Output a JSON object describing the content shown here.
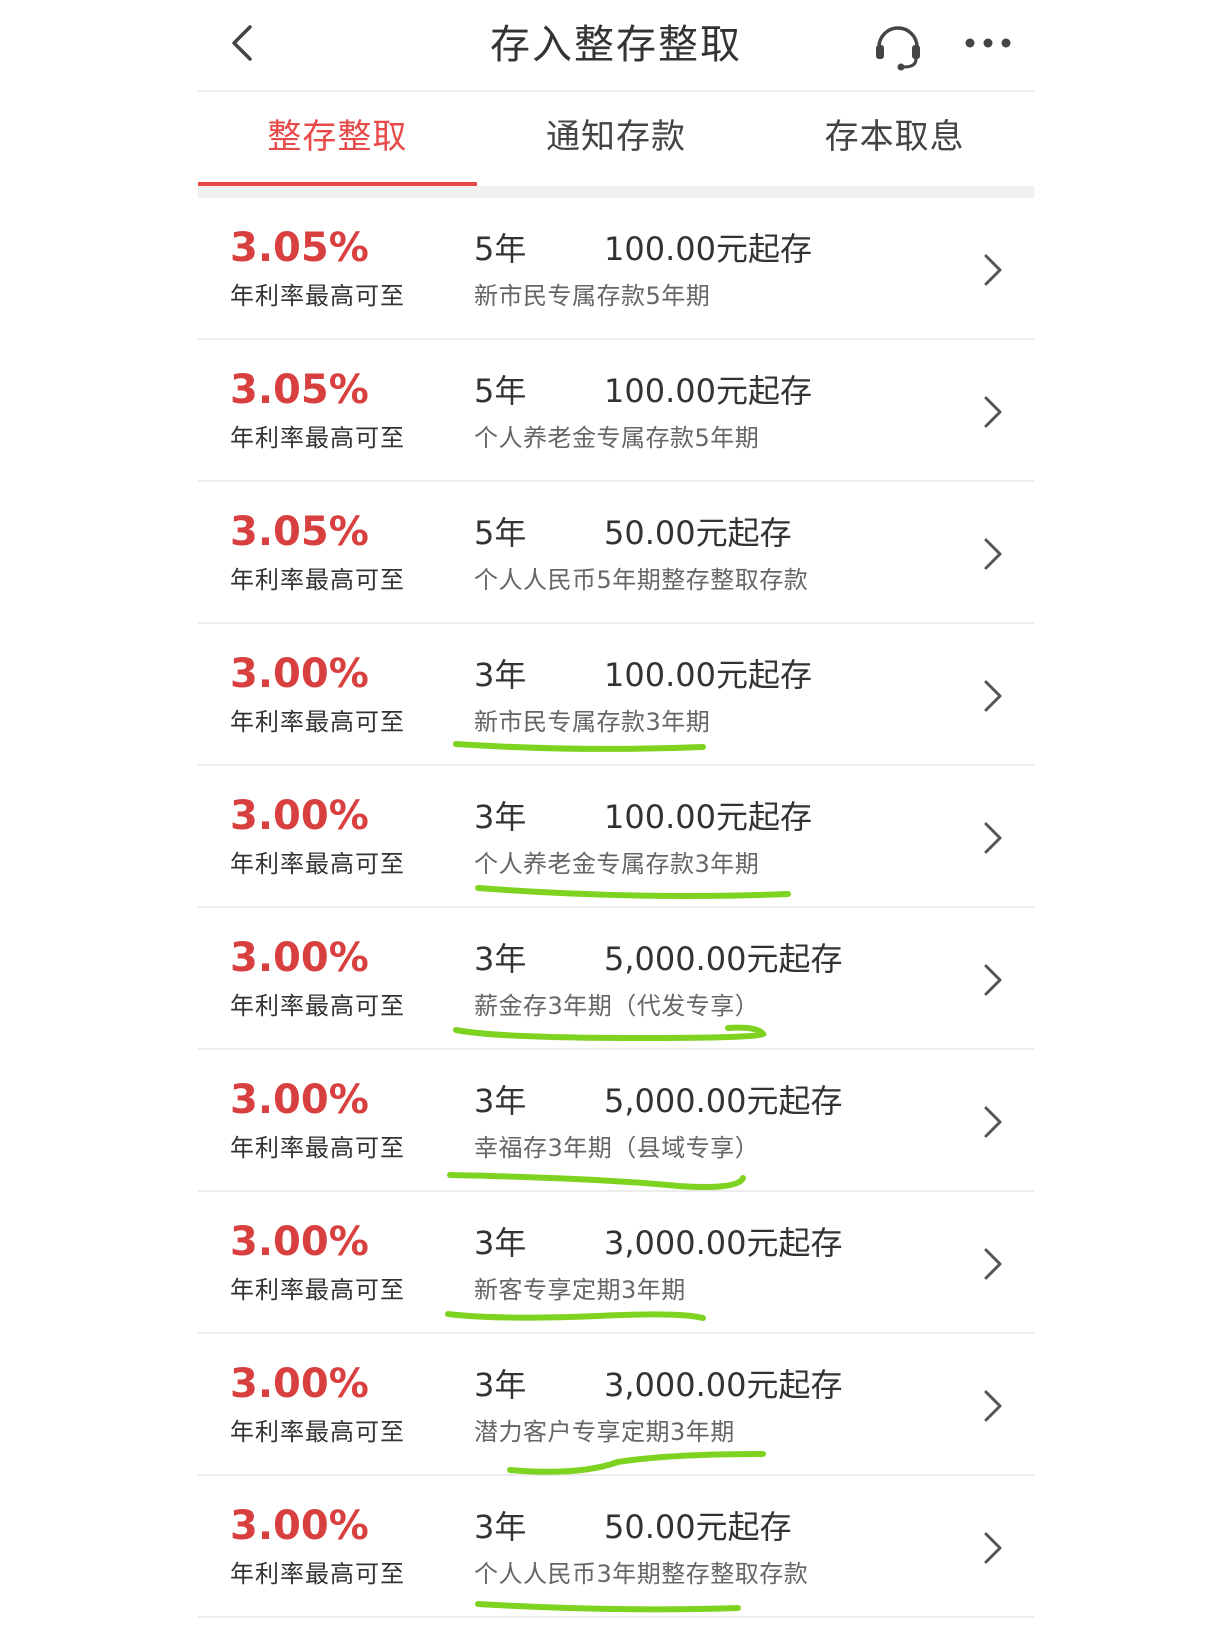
{
  "header": {
    "title": "存入整存整取",
    "back_icon": "chevron-left-icon",
    "support_icon": "headset-icon",
    "more_icon": "more-dots-icon"
  },
  "tabs": [
    {
      "label": "整存整取",
      "active": true
    },
    {
      "label": "通知存款",
      "active": false
    },
    {
      "label": "存本取息",
      "active": false
    }
  ],
  "colors": {
    "accent": "#e84a4a",
    "rate": "#d83f3f",
    "highlight_marker": "#7ed321"
  },
  "products": [
    {
      "rate": "3.05%",
      "rate_label": "年利率最高可至",
      "term": "5年",
      "minimum": "100.00元起存",
      "name": "新市民专属存款5年期",
      "highlighted": false
    },
    {
      "rate": "3.05%",
      "rate_label": "年利率最高可至",
      "term": "5年",
      "minimum": "100.00元起存",
      "name": "个人养老金专属存款5年期",
      "highlighted": false
    },
    {
      "rate": "3.05%",
      "rate_label": "年利率最高可至",
      "term": "5年",
      "minimum": "50.00元起存",
      "name": "个人人民币5年期整存整取存款",
      "highlighted": false
    },
    {
      "rate": "3.00%",
      "rate_label": "年利率最高可至",
      "term": "3年",
      "minimum": "100.00元起存",
      "name": "新市民专属存款3年期",
      "highlighted": true
    },
    {
      "rate": "3.00%",
      "rate_label": "年利率最高可至",
      "term": "3年",
      "minimum": "100.00元起存",
      "name": "个人养老金专属存款3年期",
      "highlighted": true
    },
    {
      "rate": "3.00%",
      "rate_label": "年利率最高可至",
      "term": "3年",
      "minimum": "5,000.00元起存",
      "name": "薪金存3年期（代发专享）",
      "highlighted": true
    },
    {
      "rate": "3.00%",
      "rate_label": "年利率最高可至",
      "term": "3年",
      "minimum": "5,000.00元起存",
      "name": "幸福存3年期（县域专享）",
      "highlighted": true
    },
    {
      "rate": "3.00%",
      "rate_label": "年利率最高可至",
      "term": "3年",
      "minimum": "3,000.00元起存",
      "name": "新客专享定期3年期",
      "highlighted": true
    },
    {
      "rate": "3.00%",
      "rate_label": "年利率最高可至",
      "term": "3年",
      "minimum": "3,000.00元起存",
      "name": "潜力客户专享定期3年期",
      "highlighted": true
    },
    {
      "rate": "3.00%",
      "rate_label": "年利率最高可至",
      "term": "3年",
      "minimum": "50.00元起存",
      "name": "个人人民币3年期整存整取存款",
      "highlighted": true
    }
  ]
}
